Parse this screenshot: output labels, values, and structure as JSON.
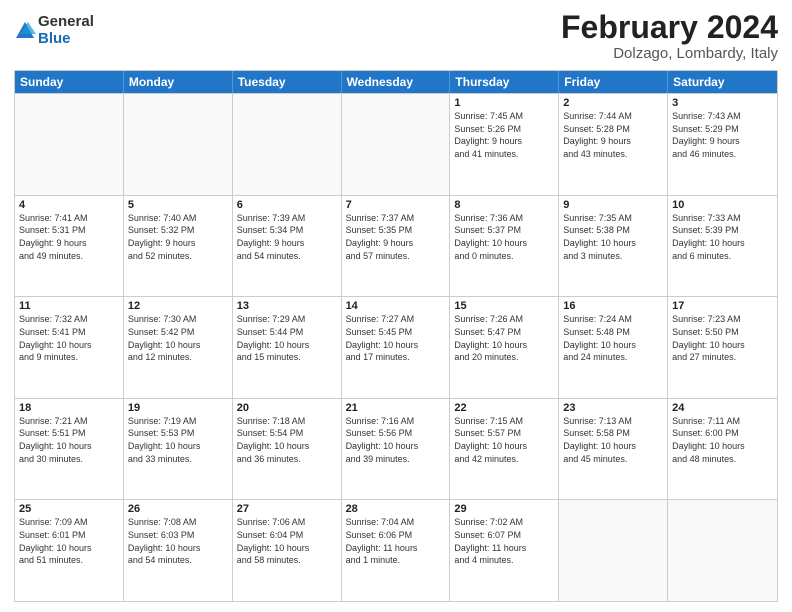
{
  "logo": {
    "general": "General",
    "blue": "Blue"
  },
  "title": {
    "month_year": "February 2024",
    "location": "Dolzago, Lombardy, Italy"
  },
  "days_of_week": [
    "Sunday",
    "Monday",
    "Tuesday",
    "Wednesday",
    "Thursday",
    "Friday",
    "Saturday"
  ],
  "weeks": [
    [
      {
        "day": "",
        "info": ""
      },
      {
        "day": "",
        "info": ""
      },
      {
        "day": "",
        "info": ""
      },
      {
        "day": "",
        "info": ""
      },
      {
        "day": "1",
        "info": "Sunrise: 7:45 AM\nSunset: 5:26 PM\nDaylight: 9 hours\nand 41 minutes."
      },
      {
        "day": "2",
        "info": "Sunrise: 7:44 AM\nSunset: 5:28 PM\nDaylight: 9 hours\nand 43 minutes."
      },
      {
        "day": "3",
        "info": "Sunrise: 7:43 AM\nSunset: 5:29 PM\nDaylight: 9 hours\nand 46 minutes."
      }
    ],
    [
      {
        "day": "4",
        "info": "Sunrise: 7:41 AM\nSunset: 5:31 PM\nDaylight: 9 hours\nand 49 minutes."
      },
      {
        "day": "5",
        "info": "Sunrise: 7:40 AM\nSunset: 5:32 PM\nDaylight: 9 hours\nand 52 minutes."
      },
      {
        "day": "6",
        "info": "Sunrise: 7:39 AM\nSunset: 5:34 PM\nDaylight: 9 hours\nand 54 minutes."
      },
      {
        "day": "7",
        "info": "Sunrise: 7:37 AM\nSunset: 5:35 PM\nDaylight: 9 hours\nand 57 minutes."
      },
      {
        "day": "8",
        "info": "Sunrise: 7:36 AM\nSunset: 5:37 PM\nDaylight: 10 hours\nand 0 minutes."
      },
      {
        "day": "9",
        "info": "Sunrise: 7:35 AM\nSunset: 5:38 PM\nDaylight: 10 hours\nand 3 minutes."
      },
      {
        "day": "10",
        "info": "Sunrise: 7:33 AM\nSunset: 5:39 PM\nDaylight: 10 hours\nand 6 minutes."
      }
    ],
    [
      {
        "day": "11",
        "info": "Sunrise: 7:32 AM\nSunset: 5:41 PM\nDaylight: 10 hours\nand 9 minutes."
      },
      {
        "day": "12",
        "info": "Sunrise: 7:30 AM\nSunset: 5:42 PM\nDaylight: 10 hours\nand 12 minutes."
      },
      {
        "day": "13",
        "info": "Sunrise: 7:29 AM\nSunset: 5:44 PM\nDaylight: 10 hours\nand 15 minutes."
      },
      {
        "day": "14",
        "info": "Sunrise: 7:27 AM\nSunset: 5:45 PM\nDaylight: 10 hours\nand 17 minutes."
      },
      {
        "day": "15",
        "info": "Sunrise: 7:26 AM\nSunset: 5:47 PM\nDaylight: 10 hours\nand 20 minutes."
      },
      {
        "day": "16",
        "info": "Sunrise: 7:24 AM\nSunset: 5:48 PM\nDaylight: 10 hours\nand 24 minutes."
      },
      {
        "day": "17",
        "info": "Sunrise: 7:23 AM\nSunset: 5:50 PM\nDaylight: 10 hours\nand 27 minutes."
      }
    ],
    [
      {
        "day": "18",
        "info": "Sunrise: 7:21 AM\nSunset: 5:51 PM\nDaylight: 10 hours\nand 30 minutes."
      },
      {
        "day": "19",
        "info": "Sunrise: 7:19 AM\nSunset: 5:53 PM\nDaylight: 10 hours\nand 33 minutes."
      },
      {
        "day": "20",
        "info": "Sunrise: 7:18 AM\nSunset: 5:54 PM\nDaylight: 10 hours\nand 36 minutes."
      },
      {
        "day": "21",
        "info": "Sunrise: 7:16 AM\nSunset: 5:56 PM\nDaylight: 10 hours\nand 39 minutes."
      },
      {
        "day": "22",
        "info": "Sunrise: 7:15 AM\nSunset: 5:57 PM\nDaylight: 10 hours\nand 42 minutes."
      },
      {
        "day": "23",
        "info": "Sunrise: 7:13 AM\nSunset: 5:58 PM\nDaylight: 10 hours\nand 45 minutes."
      },
      {
        "day": "24",
        "info": "Sunrise: 7:11 AM\nSunset: 6:00 PM\nDaylight: 10 hours\nand 48 minutes."
      }
    ],
    [
      {
        "day": "25",
        "info": "Sunrise: 7:09 AM\nSunset: 6:01 PM\nDaylight: 10 hours\nand 51 minutes."
      },
      {
        "day": "26",
        "info": "Sunrise: 7:08 AM\nSunset: 6:03 PM\nDaylight: 10 hours\nand 54 minutes."
      },
      {
        "day": "27",
        "info": "Sunrise: 7:06 AM\nSunset: 6:04 PM\nDaylight: 10 hours\nand 58 minutes."
      },
      {
        "day": "28",
        "info": "Sunrise: 7:04 AM\nSunset: 6:06 PM\nDaylight: 11 hours\nand 1 minute."
      },
      {
        "day": "29",
        "info": "Sunrise: 7:02 AM\nSunset: 6:07 PM\nDaylight: 11 hours\nand 4 minutes."
      },
      {
        "day": "",
        "info": ""
      },
      {
        "day": "",
        "info": ""
      }
    ]
  ]
}
